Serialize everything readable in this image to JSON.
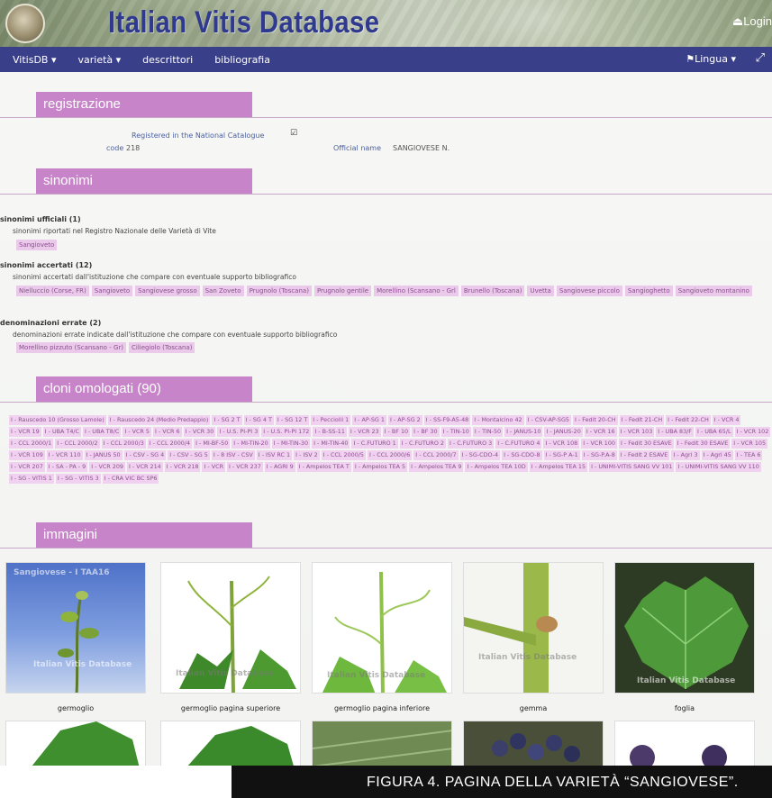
{
  "header": {
    "title": "Italian Vitis Database",
    "login": "Login"
  },
  "nav": {
    "items": [
      "VitisDB ▾",
      "varietà ▾",
      "descrittori",
      "bibliografia"
    ],
    "lingua": "Lingua ▾"
  },
  "registrazione": {
    "title": "registrazione",
    "registered_label": "Registered in the National Catalogue",
    "registered_value": "☑",
    "code_label": "code",
    "code_value": "218",
    "official_name_label": "Official name",
    "official_name_value": "SANGIOVESE N."
  },
  "sinonimi": {
    "title": "sinonimi",
    "ufficiali": {
      "title": "sinonimi ufficiali (1)",
      "desc": "sinonimi riportati nel Registro Nazionale delle Varietà di Vite",
      "tags": [
        "Sangioveto"
      ]
    },
    "accertati": {
      "title": "sinonimi accertati (12)",
      "desc": "sinonimi accertati dall'istituzione che compare con eventuale supporto bibliografico",
      "tags": [
        "Nielluccio (Corse, FR)",
        "Sangioveto",
        "Sangiovese grosso",
        "San Zoveto",
        "Prugnolo (Toscana)",
        "Prugnolo gentile",
        "Morellino (Scansano - Grl",
        "Brunello (Toscana)",
        "Uvetta",
        "Sangiovese piccolo",
        "Sangioghetto",
        "Sangioveto montanino"
      ]
    },
    "errate": {
      "title": "denominazioni errate (2)",
      "desc": "denominazioni errate indicate dall'istituzione che compare con eventuale supporto bibliografico",
      "tags": [
        "Morellino pizzuto (Scansano - Gr)",
        "Ciliegiolo (Toscana)"
      ]
    }
  },
  "cloni": {
    "title": "cloni omologati (90)",
    "tags": [
      "I - Rauscedo 10 (Grosso Lamole)",
      "I - Rauscedo 24 (Medio Predappio)",
      "I - SG 2 T",
      "I - SG 4 T",
      "I - SG 12 T",
      "I - Pecciolii 1",
      "I - AP-SG 1",
      "I - AP-SG 2",
      "I - SS-F9-A5-48",
      "I - Montalcino 42",
      "I - CSV-AP-SG5",
      "I - Fedit 20-CH",
      "I - Fedit 21-CH",
      "I - Fedit 22-CH",
      "I - VCR 4",
      "I - VCR 19",
      "I - UBA T4/C",
      "I - UBA T8/C",
      "I - VCR 5",
      "I - VCR 6",
      "I - VCR 30",
      "I - U.S. PI-PI 3",
      "I - U.S. PI-PI 172",
      "I - B-SS-11",
      "I - VCR 23",
      "I - BF 10",
      "I - BF 30",
      "I - TIN-10",
      "I - TIN-50",
      "I - JANUS-10",
      "I - JANUS-20",
      "I - VCR 16",
      "I - VCR 103",
      "I - UBA 83/F",
      "I - UBA 65/L",
      "I - VCR 102",
      "I - CCL 2000/1",
      "I - CCL 2000/2",
      "I - CCL 2000/3",
      "I - CCL 2000/4",
      "I - MI-BF-50",
      "I - MI-TIN-20",
      "I - MI-TIN-30",
      "I - MI-TIN-40",
      "I - C.FUTURO 1",
      "I - C.FUTURO 2",
      "I - C.FUTURO 3",
      "I - C.FUTURO 4",
      "I - VCR 108",
      "I - VCR 100",
      "I - Fedit 30 ESAVE",
      "I - Fedit 30 ESAVE",
      "I - VCR 105",
      "I - VCR 109",
      "I - VCR 110",
      "I - JANUS 50",
      "I - CSV - SG 4",
      "I - CSV - SG 5",
      "I - 8 ISV - CSV",
      "I - ISV RC 1",
      "I - ISV 2",
      "I - CCL 2000/5",
      "I - CCL 2000/6",
      "I - CCL 2000/7",
      "I - SG-CDO-4",
      "I - SG-CDO-8",
      "I - SG-P A-1",
      "I - SG-P.A-8",
      "I - Fedit 2 ESAVE",
      "I - Agri 3",
      "I - Agri 45",
      "I - TEA 6",
      "I - VCR 207",
      "I - SA - PA - 9",
      "I - VCR 209",
      "I - VCR 214",
      "I - VCR 218",
      "I - VCR",
      "I - VCR 237",
      "I - AGRI 9",
      "I - Ampelos TEA T",
      "I - Ampelos TEA 5",
      "I - Ampelos TEA 9",
      "I - Ampelos TEA 10D",
      "I - Ampelos TEA 15",
      "I - UNIMI-VITIS SANG VV 101",
      "I - UNIMI-VITIS SANG VV 110",
      "I - SG - VITIS 1",
      "I - SG - VITIS 3",
      "I - CRA VIC BC SP6"
    ]
  },
  "immagini": {
    "title": "immagini",
    "captions": [
      "germoglio",
      "germoglio pagina superiore",
      "germoglio pagina inferiore",
      "gemma",
      "foglia"
    ],
    "watermark_top": "Sangiovese - I TAA16",
    "watermark_mid": "Italian Vitis Database"
  },
  "footer": {
    "caption": "FIGURA 4. PAGINA DELLA VARIETÀ “SANGIOVESE”."
  },
  "colors": {
    "nav": "#3a3f8a",
    "section_tab": "#c784c9",
    "tag_bg": "#eac9ea",
    "title": "#2f3a8f"
  }
}
